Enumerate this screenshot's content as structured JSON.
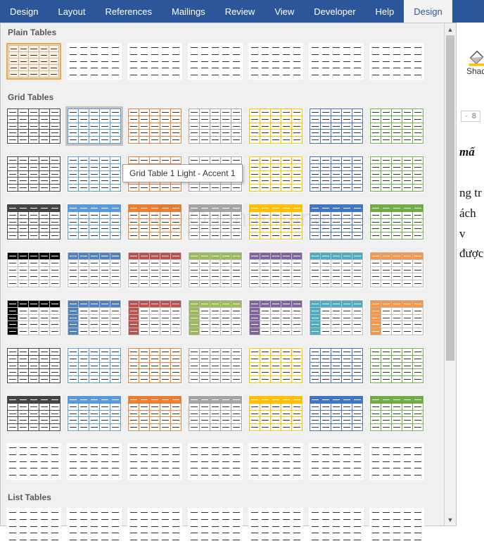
{
  "ribbon": {
    "tabs": [
      {
        "label": "Design",
        "active": false
      },
      {
        "label": "Layout",
        "active": false
      },
      {
        "label": "References",
        "active": false
      },
      {
        "label": "Mailings",
        "active": false
      },
      {
        "label": "Review",
        "active": false
      },
      {
        "label": "View",
        "active": false
      },
      {
        "label": "Developer",
        "active": false
      },
      {
        "label": "Help",
        "active": false
      },
      {
        "label": "Design",
        "active": true
      }
    ]
  },
  "gallery": {
    "categories": [
      {
        "name": "Plain Tables",
        "key": "plain"
      },
      {
        "name": "Grid Tables",
        "key": "grid"
      },
      {
        "name": "List Tables",
        "key": "list"
      }
    ],
    "tooltip": "Grid Table 1 Light - Accent 1",
    "accent_colors": [
      "#444444",
      "#5b9bd5",
      "#ed7d31",
      "#a5a5a5",
      "#ffc000",
      "#4472c4",
      "#70ad47"
    ],
    "accent_alt": [
      "#000000",
      "#4f81bd",
      "#c0504d",
      "#9bbb59",
      "#8064a2",
      "#4bacc6",
      "#f79646"
    ]
  },
  "right_panel": {
    "shading_label": "Shad",
    "ruler_value": "8"
  },
  "document": {
    "italic_fragment": "mấ",
    "line1": "ng tr",
    "line2": "ách v",
    "line3": "được"
  },
  "watermark_text": "Quantrimang"
}
